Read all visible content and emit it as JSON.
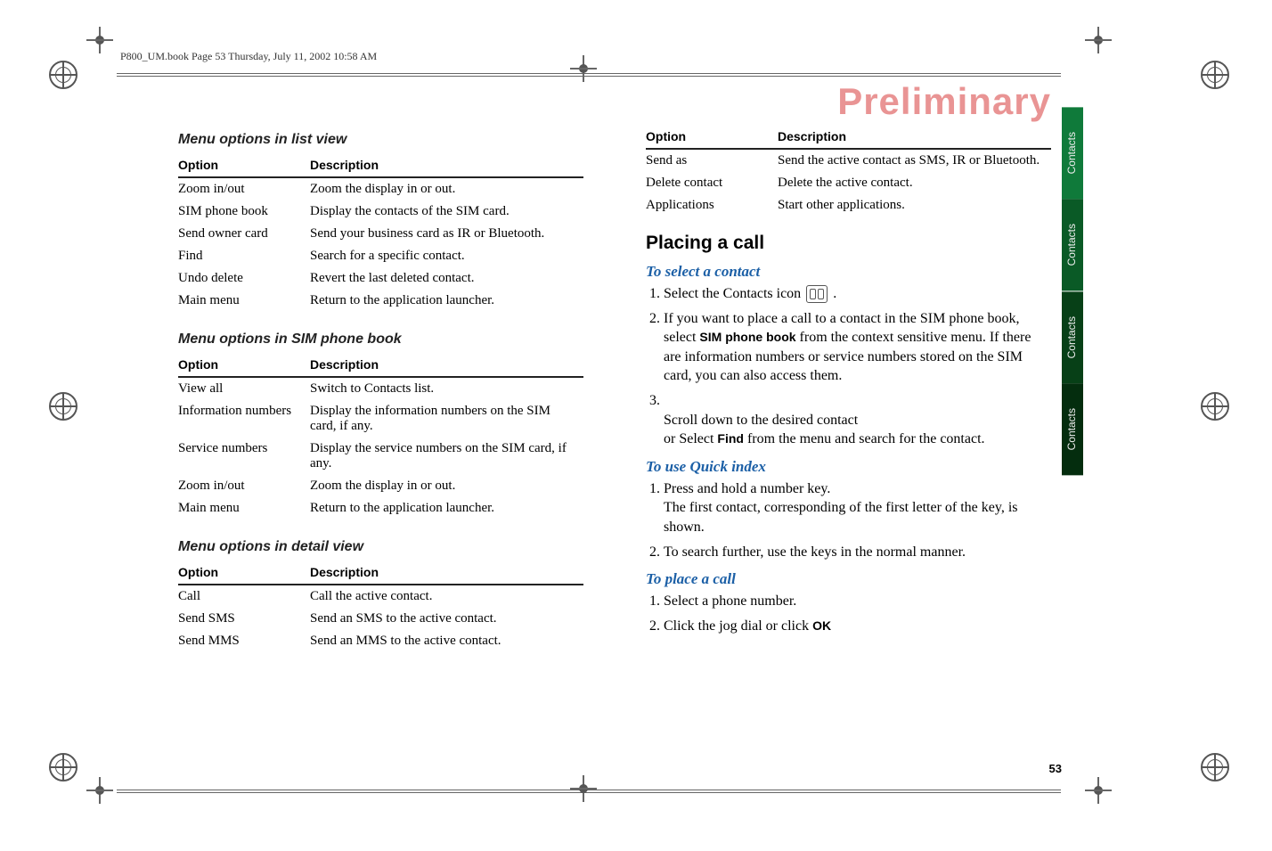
{
  "header_info": "P800_UM.book  Page 53  Thursday, July 11, 2002  10:58 AM",
  "watermark": "Preliminary",
  "page_number": "53",
  "side_tabs": [
    "Contacts",
    "Contacts",
    "Contacts",
    "Contacts"
  ],
  "left": {
    "list_view_heading": "Menu options in list view",
    "sim_book_heading": "Menu options in SIM phone book",
    "detail_view_heading": "Menu options in detail view",
    "headers": {
      "option": "Option",
      "description": "Description"
    },
    "list_view": [
      {
        "opt": "Zoom in/out",
        "desc": "Zoom the display in or out."
      },
      {
        "opt": "SIM phone book",
        "desc": "Display the contacts of the SIM card."
      },
      {
        "opt": "Send owner card",
        "desc": "Send your business card as IR or Bluetooth."
      },
      {
        "opt": "Find",
        "desc": "Search for a specific contact."
      },
      {
        "opt": "Undo delete",
        "desc": "Revert the last deleted contact."
      },
      {
        "opt": "Main menu",
        "desc": "Return to the application launcher."
      }
    ],
    "sim_book": [
      {
        "opt": "View all",
        "desc": "Switch to Contacts list."
      },
      {
        "opt": "Information numbers",
        "desc": "Display the information numbers on the SIM card, if any."
      },
      {
        "opt": "Service numbers",
        "desc": "Display the service numbers on the SIM card, if any."
      },
      {
        "opt": "Zoom in/out",
        "desc": "Zoom the display in or out."
      },
      {
        "opt": "Main menu",
        "desc": "Return to the application launcher."
      }
    ],
    "detail_view": [
      {
        "opt": "Call",
        "desc": "Call the active contact."
      },
      {
        "opt": "Send SMS",
        "desc": "Send an SMS to the active contact."
      },
      {
        "opt": "Send MMS",
        "desc": "Send an MMS to the active contact."
      }
    ]
  },
  "right": {
    "headers": {
      "option": "Option",
      "description": "Description"
    },
    "detail_cont": [
      {
        "opt": "Send as",
        "desc": "Send the active contact as SMS, IR or Bluetooth."
      },
      {
        "opt": "Delete contact",
        "desc": "Delete the active contact."
      },
      {
        "opt": "Applications",
        "desc": "Start other applications."
      }
    ],
    "placing_heading": "Placing a call",
    "select_contact_heading": "To select a contact",
    "select_steps": {
      "s1_pre": "Select the Contacts icon ",
      "s1_post": " .",
      "s2_pre": "If you want to place a call to a contact in the SIM phone book, select ",
      "s2_ui": "SIM phone book",
      "s2_post": " from the context sensitive menu. If there are information numbers or service numbers stored on the SIM card, you can also access them.",
      "s3_pre": "Scroll down to the desired contact\nor Select ",
      "s3_ui": "Find",
      "s3_post": " from the menu and search for the contact."
    },
    "quick_heading": "To use Quick index",
    "quick_steps": {
      "s1": "Press and hold a number key.\nThe first contact, corresponding of the first letter of the key, is shown.",
      "s2": "To search further, use the keys in the normal manner."
    },
    "place_heading": "To place a call",
    "place_steps": {
      "s1": "Select a phone number.",
      "s2_pre": "Click the jog dial or click ",
      "s2_ui": "OK"
    }
  }
}
